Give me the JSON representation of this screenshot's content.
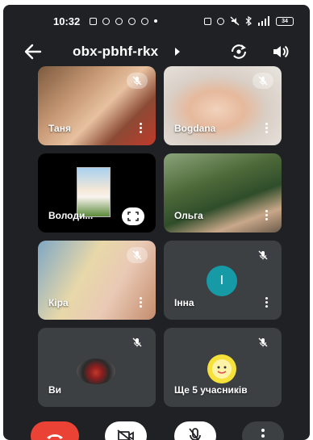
{
  "status_bar": {
    "time": "10:32",
    "battery": "34"
  },
  "header": {
    "meeting_code": "obx-pbhf-rkx",
    "icons": [
      "back-arrow-icon",
      "switch-camera-icon",
      "speaker-icon"
    ]
  },
  "participants": [
    {
      "name": "Таня",
      "muted": true
    },
    {
      "name": "Bogdana",
      "muted": true
    },
    {
      "name": "Володи...",
      "muted": false,
      "screen_share": true
    },
    {
      "name": "Ольга",
      "muted": false
    },
    {
      "name": "Кіра",
      "muted": true
    },
    {
      "name": "Інна",
      "muted": true,
      "avatar_letter": "І"
    },
    {
      "name": "Ви",
      "muted": true
    },
    {
      "name": "Ще 5 учасників",
      "muted": true
    }
  ],
  "colors": {
    "background": "#202124",
    "tile": "#3c4043",
    "end_call": "#ea4335",
    "avatar_teal": "#159aa6"
  },
  "controls": [
    "end-call-icon",
    "camera-off-icon",
    "mic-off-icon",
    "more-vert-icon"
  ]
}
